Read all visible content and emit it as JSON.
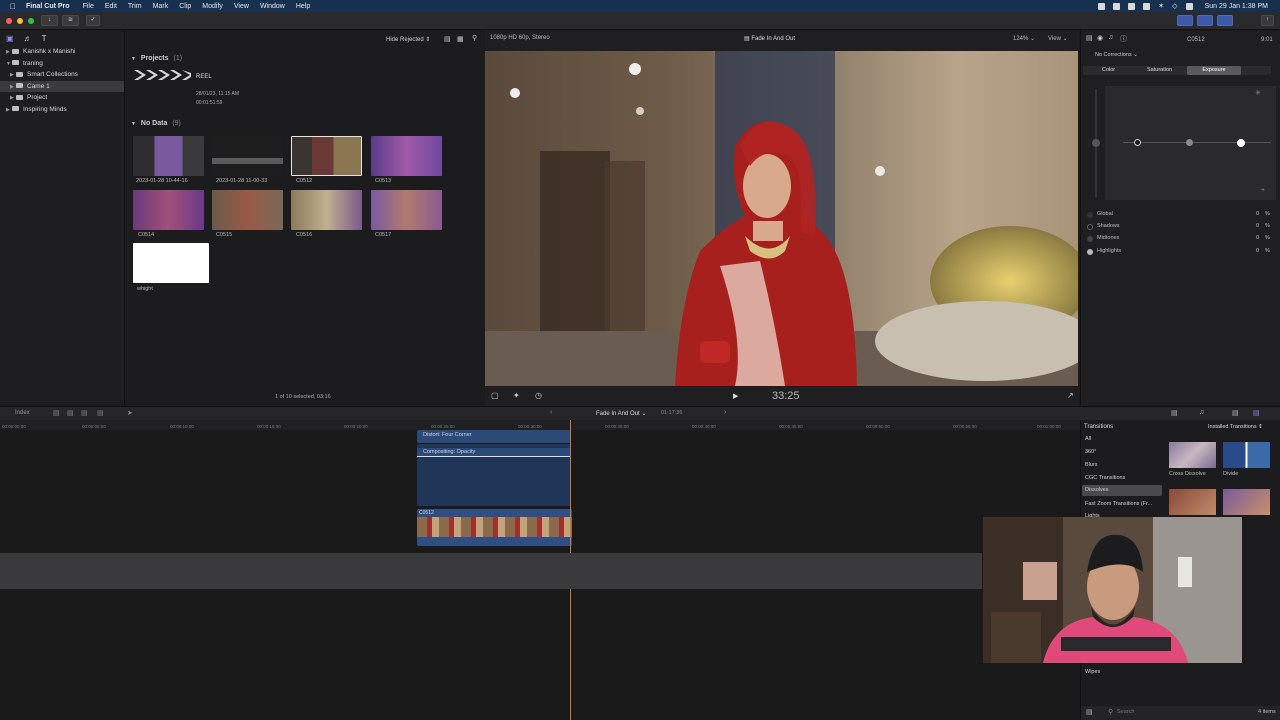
{
  "menubar": {
    "app_name": "Final Cut Pro",
    "items": [
      "File",
      "Edit",
      "Trim",
      "Mark",
      "Clip",
      "Modify",
      "View",
      "Window",
      "Help"
    ],
    "clock": "Sun 29 Jan  1:38 PM"
  },
  "library": {
    "rows": [
      {
        "label": "Kanishk x Manishi",
        "indent": 0
      },
      {
        "label": "traning",
        "indent": 0
      },
      {
        "label": "Smart Collections",
        "indent": 1
      },
      {
        "label": "Came 1",
        "indent": 1
      },
      {
        "label": "Project",
        "indent": 1
      },
      {
        "label": "Inspiring Minds",
        "indent": 0
      }
    ]
  },
  "browser": {
    "filter": "Hide Rejected",
    "projects_header": "Projects",
    "projects_count": "(1)",
    "project": {
      "name": "REEL",
      "date": "28/01/23, 11:15 AM",
      "duration": "00:01:51:59"
    },
    "nodata_header": "No Data",
    "nodata_count": "(9)",
    "clips": [
      {
        "label": "2023-01-28 10-44-16"
      },
      {
        "label": "2023-01-28 11-00-33"
      },
      {
        "label": "C0512"
      },
      {
        "label": "C0513"
      },
      {
        "label": "C0514"
      },
      {
        "label": "C0515"
      },
      {
        "label": "C0516"
      },
      {
        "label": "C0517"
      },
      {
        "label": "whight"
      }
    ],
    "status": "1 of 10 selected, 03:16"
  },
  "viewer": {
    "format": "1080p HD 60p, Stereo",
    "title": "Fade In And Out",
    "zoom": "124%",
    "view_label": "View",
    "timecode": "33:25"
  },
  "inspector": {
    "clip": "C0512",
    "duration": "9:01",
    "corrections": "No Corrections",
    "tabs": [
      "Color",
      "Saturation",
      "Exposure"
    ],
    "active_tab": "Exposure",
    "rows": [
      {
        "label": "Global",
        "value": "0",
        "unit": "%"
      },
      {
        "label": "Shadows",
        "value": "0",
        "unit": "%"
      },
      {
        "label": "Midtones",
        "value": "0",
        "unit": "%"
      },
      {
        "label": "Highlights",
        "value": "0",
        "unit": "%"
      }
    ]
  },
  "timeline": {
    "index_label": "Index",
    "project": "Fade In And Out",
    "project_duration": "01:17:36",
    "ruler": [
      "00:00:00:00",
      "00:00:05:00",
      "00:00:10:00",
      "00:00:15:00",
      "00:00:20:00",
      "00:00:25:00",
      "00:00:30:00",
      "00:00:35:00",
      "00:00:40:00",
      "00:00:45:00",
      "00:00:50:00",
      "00:00:55:00",
      "00:01:00:00"
    ],
    "title_clip": "Distort: Four Corner",
    "effect_clip": "Compositing: Opacity",
    "video_clip": "C0512"
  },
  "transitions": {
    "header": "Transitions",
    "installed": "Installed Transitions",
    "categories": [
      "All",
      "360°",
      "Blurs",
      "CGC Transitions",
      "Dissolves",
      "Fast Zoom Transitions (Fr...",
      "Lights",
      "Wipes"
    ],
    "selected_category": "Dissolves",
    "items": [
      {
        "label": "Cross Dissolve"
      },
      {
        "label": "Divide"
      }
    ],
    "search_placeholder": "Search",
    "count": "4 items"
  }
}
